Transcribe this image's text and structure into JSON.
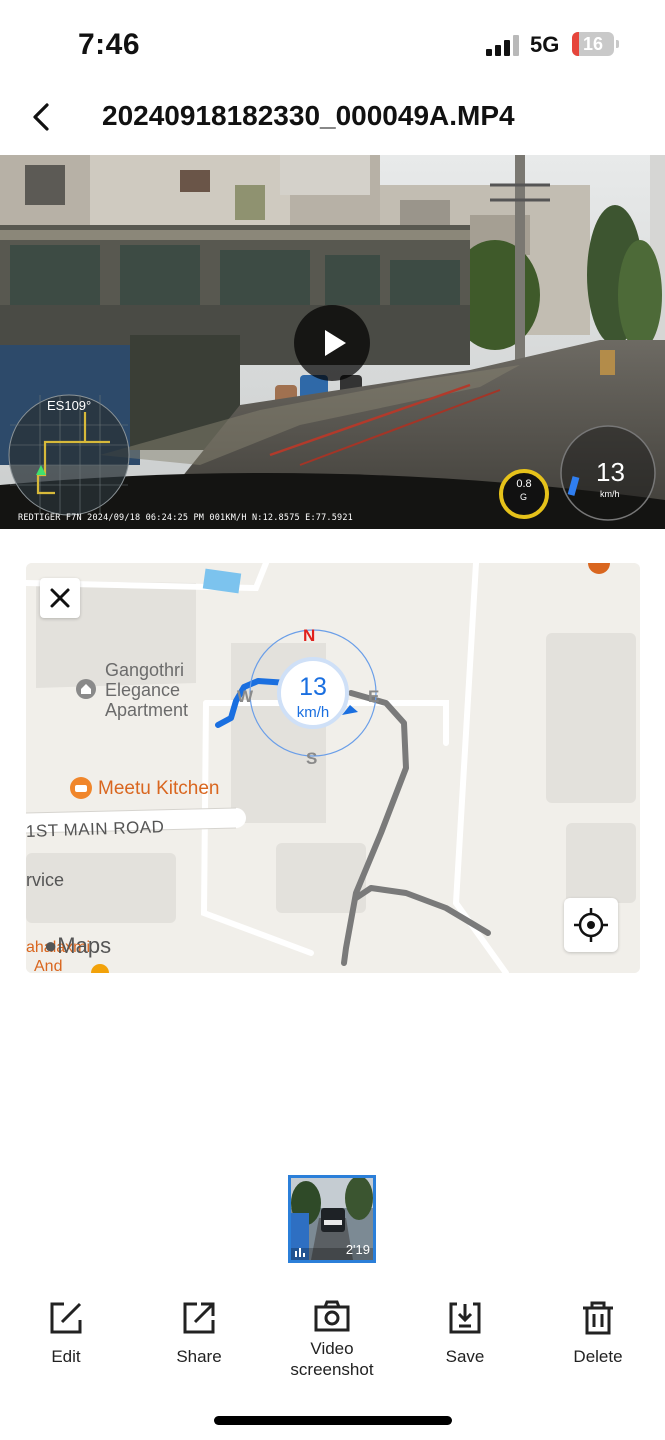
{
  "status_bar": {
    "time": "7:46",
    "network": "5G",
    "battery_level": "16",
    "battery_fraction": 0.16,
    "battery_color": "#e6453b"
  },
  "header": {
    "title": "20240918182330_000049A.MP4",
    "back_icon": "chevron-left-icon"
  },
  "video": {
    "play_icon": "play-icon",
    "heading_label": "ES109°",
    "speed_value": "13",
    "speed_unit": "km/h",
    "g_value": "0.8",
    "g_unit": "G",
    "info_line": "REDTIGER F7N 2024/09/18 06:24:25 PM 001KM/H N:12.8575 E:77.5921"
  },
  "map": {
    "close_icon": "close-icon",
    "compass": {
      "n": "N",
      "s": "S",
      "e": "E",
      "w": "W"
    },
    "speed_value": "13",
    "speed_unit": "km/h",
    "poi_1_line1": "Gangothri",
    "poi_1_line2": "Elegance",
    "poi_1_line3": "Apartment",
    "poi_2": "Meetu Kitchen",
    "road": "1ST MAIN ROAD",
    "partial_label_1": "rvice",
    "partial_label_2": "ahalaxmi",
    "partial_label_3": "And",
    "attribution": "Maps",
    "locate_icon": "crosshair-icon",
    "route_color": "#1a6fe0",
    "track_color": "#7a7a7a"
  },
  "thumbnail": {
    "duration": "2'19"
  },
  "toolbar": {
    "edit": "Edit",
    "share": "Share",
    "screenshot_line1": "Video",
    "screenshot_line2": "screenshot",
    "save": "Save",
    "delete": "Delete"
  }
}
